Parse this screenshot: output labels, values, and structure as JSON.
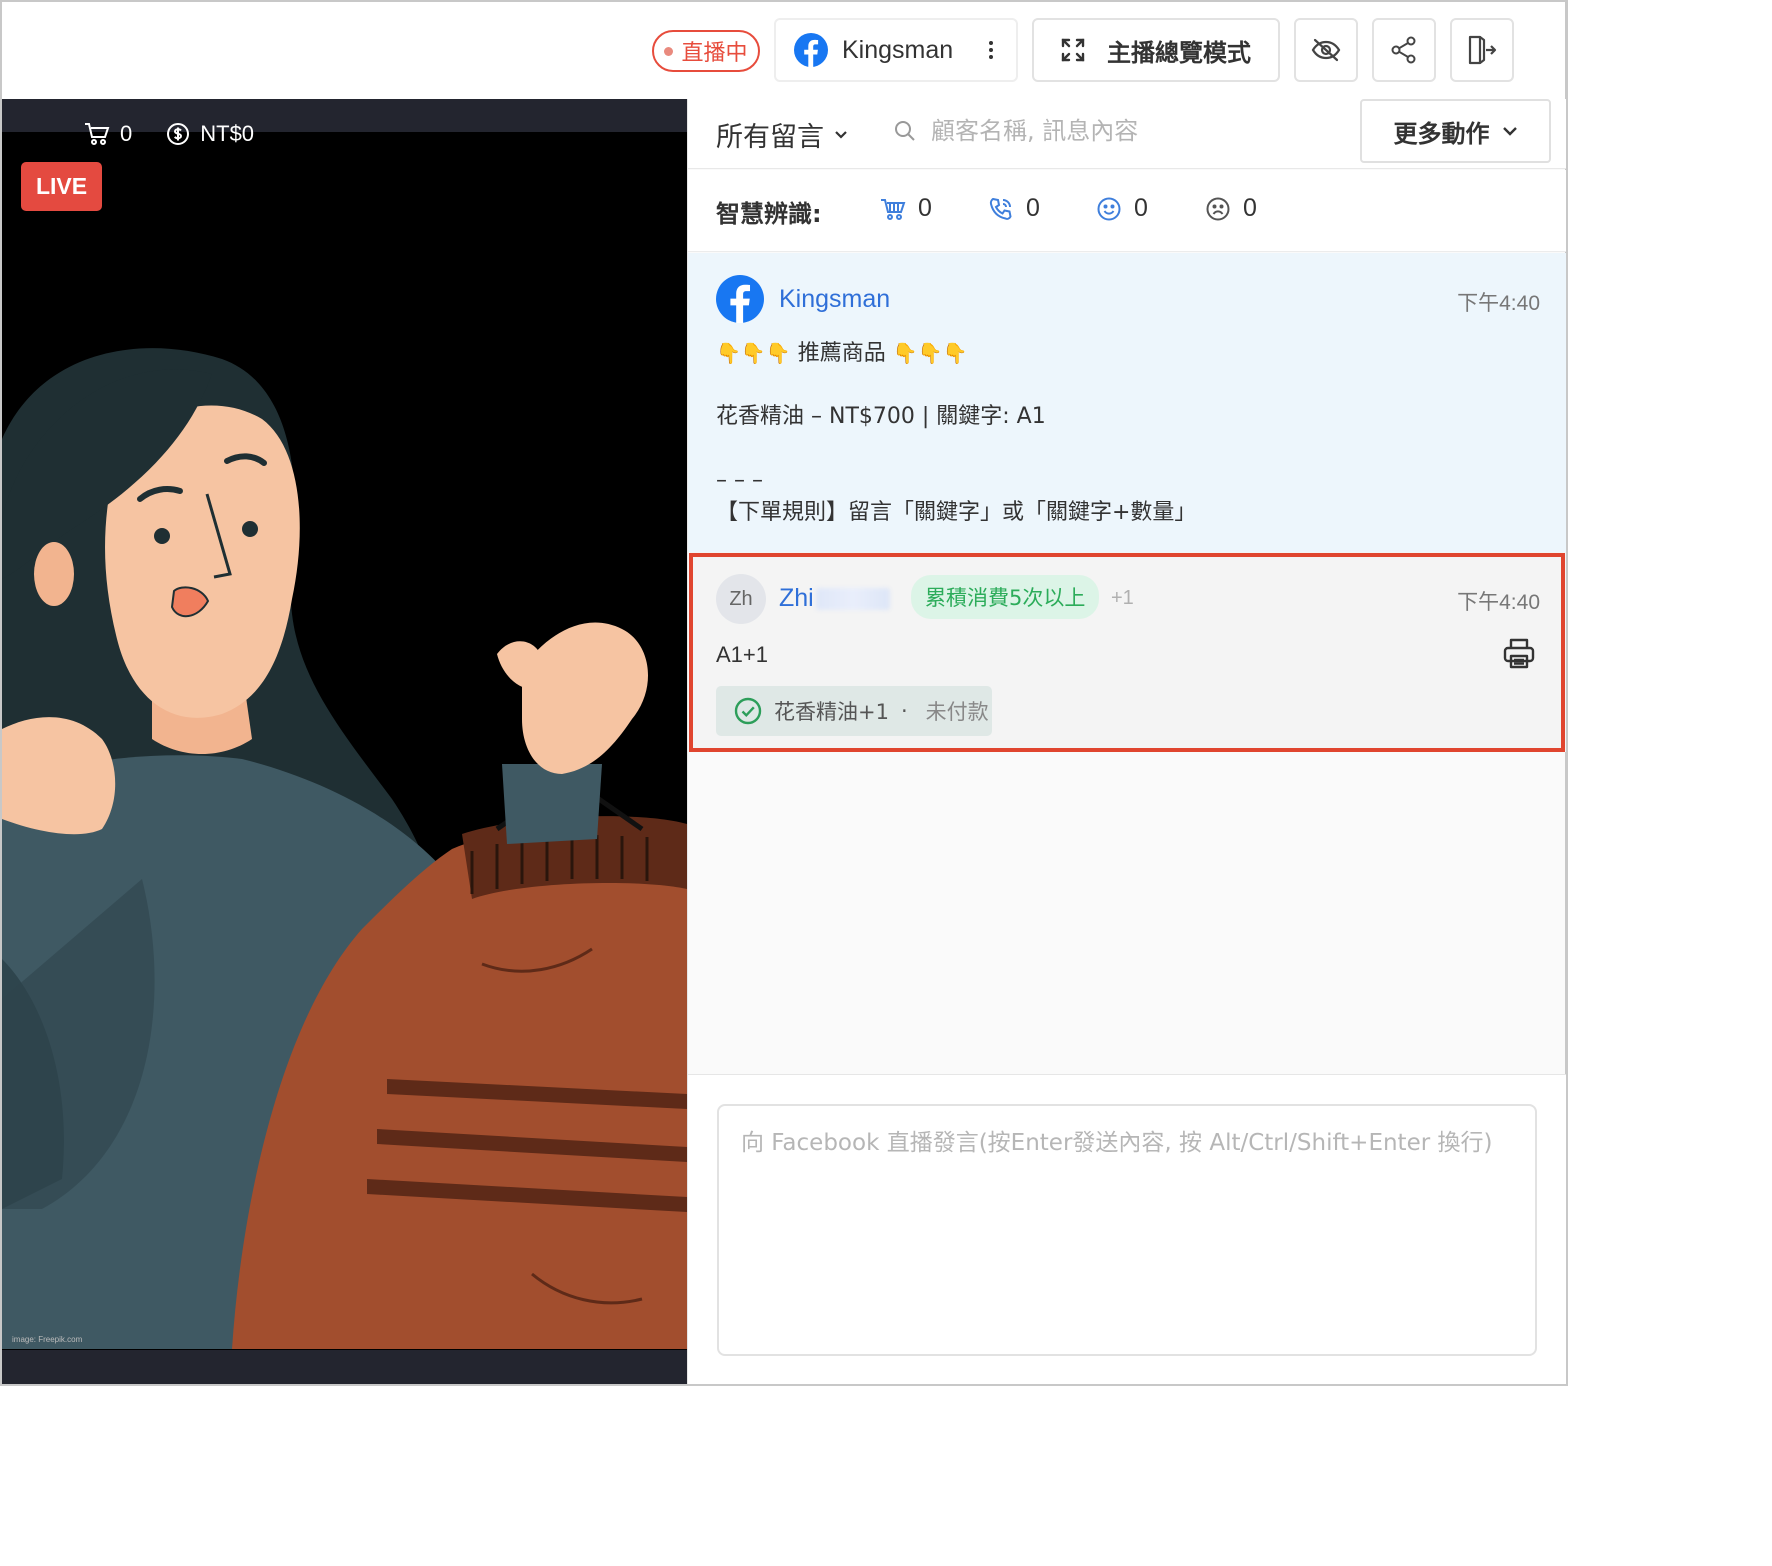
{
  "topbar": {
    "live_status": "直播中",
    "page_name": "Kingsman",
    "host_mode_label": "主播總覽模式",
    "icons": [
      "facebook-icon",
      "kebab-icon",
      "fullscreen-icon",
      "eye-off-icon",
      "share-icon",
      "exit-icon"
    ]
  },
  "video": {
    "cart_count": "0",
    "amount": "NT$0",
    "live_badge": "LIVE",
    "credit": "image: Freepik.com"
  },
  "filters": {
    "all_comments": "所有留言",
    "search_placeholder": "顧客名稱, 訊息內容",
    "more_actions": "更多動作"
  },
  "smart_detect": {
    "label": "智慧辨識:",
    "items": [
      {
        "icon": "cart-icon",
        "count": "0"
      },
      {
        "icon": "phone-icon",
        "count": "0"
      },
      {
        "icon": "smile-icon",
        "count": "0"
      },
      {
        "icon": "sad-icon",
        "count": "0"
      }
    ]
  },
  "pinned": {
    "author": "Kingsman",
    "time": "下午4:40",
    "line1": "推薦商品",
    "line2": "花香精油 – NT$700 | 關鍵字: A1",
    "line3": "– – –",
    "line4": "【下單規則】留言「關鍵字」或「關鍵字+數量」"
  },
  "comment": {
    "avatar_initials": "Zh",
    "author": "Zhi",
    "tag": "累積消費5次以上",
    "tag_more": "+1",
    "time": "下午4:40",
    "text": "A1+1",
    "order_item": "花香精油+1",
    "order_sep": "·",
    "order_status": "未付款"
  },
  "composer": {
    "placeholder": "向 Facebook 直播發言(按Enter發送內容, 按 Alt/Ctrl/Shift+Enter 換行)"
  },
  "colors": {
    "accent_red": "#e74c3c",
    "facebook_blue": "#1877f2",
    "link_blue": "#2f6fd8",
    "tag_green": "#2cac5a"
  }
}
